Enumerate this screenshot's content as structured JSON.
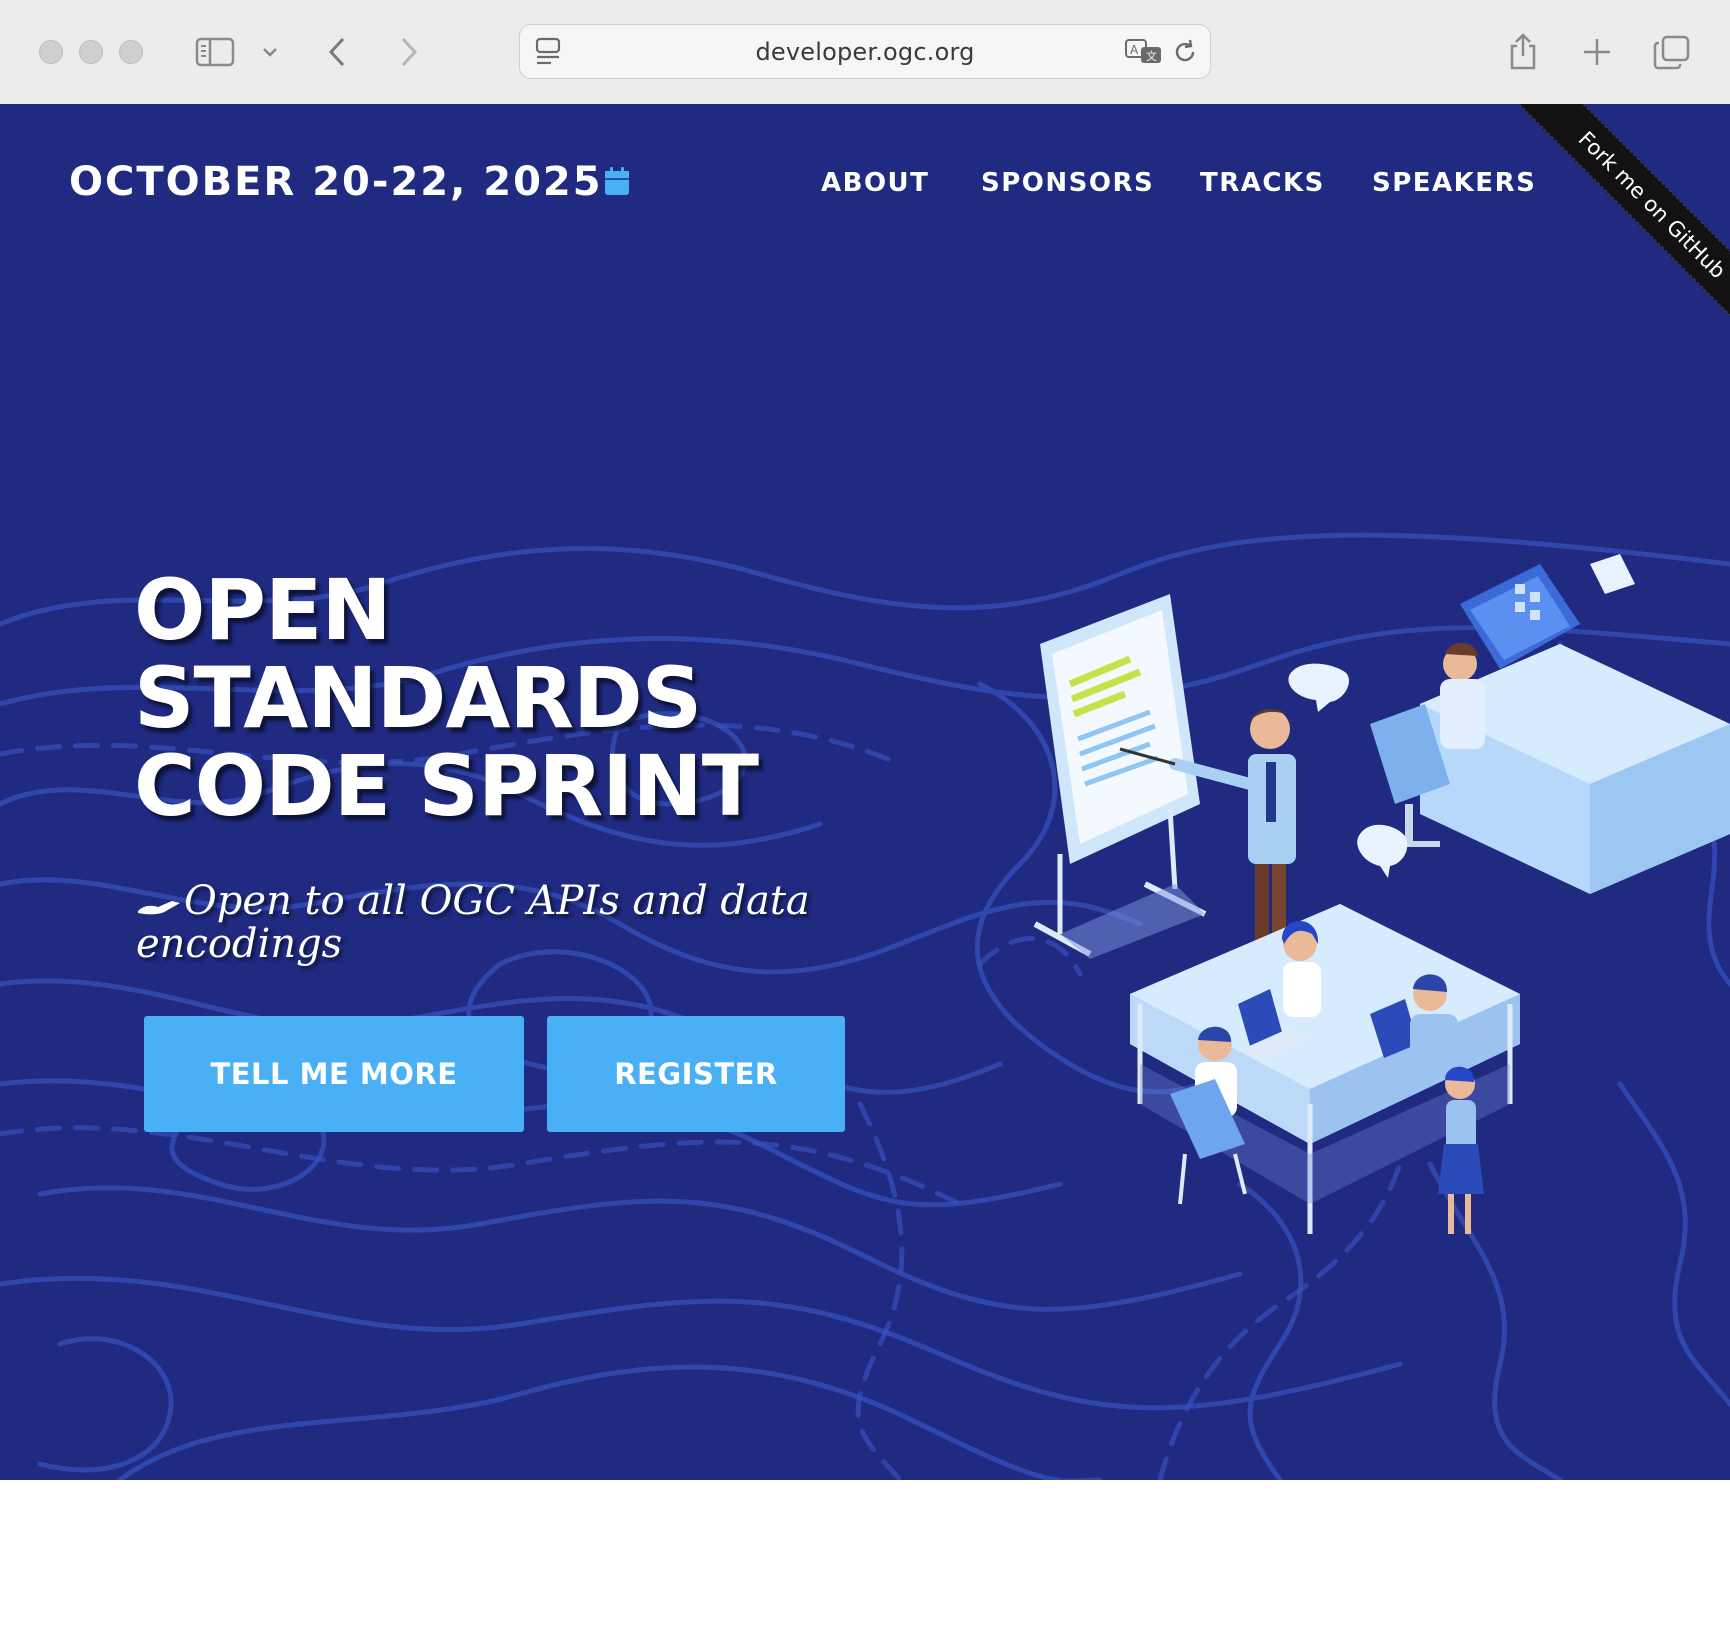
{
  "browser": {
    "url": "developer.ogc.org",
    "icons": [
      "sidebar-icon",
      "chevron-down-icon",
      "back-icon",
      "forward-icon",
      "page-icon",
      "translate-icon",
      "reload-icon",
      "share-icon",
      "new-tab-icon",
      "tabs-overview-icon"
    ]
  },
  "navbar": {
    "brand": "OCTOBER 20-22, 2025",
    "brand_icon": "calendar-icon",
    "links": [
      "ABOUT",
      "SPONSORS",
      "TRACKS",
      "SPEAKERS"
    ]
  },
  "ribbon": {
    "text": "Fork me on GitHub"
  },
  "hero": {
    "title_lines": [
      "OPEN",
      "STANDARDS",
      "CODE SPRINT"
    ],
    "subtitle": "Open to all OGC APIs and data encodings",
    "subtitle_icon": "handshake-icon",
    "buttons": {
      "primary": "TELL ME MORE",
      "secondary": "REGISTER"
    }
  },
  "colors": {
    "hero_bg": "#1f2a80",
    "contour": "#3a55c2",
    "button": "#4ab0f5",
    "chrome_bg": "#ececea"
  }
}
